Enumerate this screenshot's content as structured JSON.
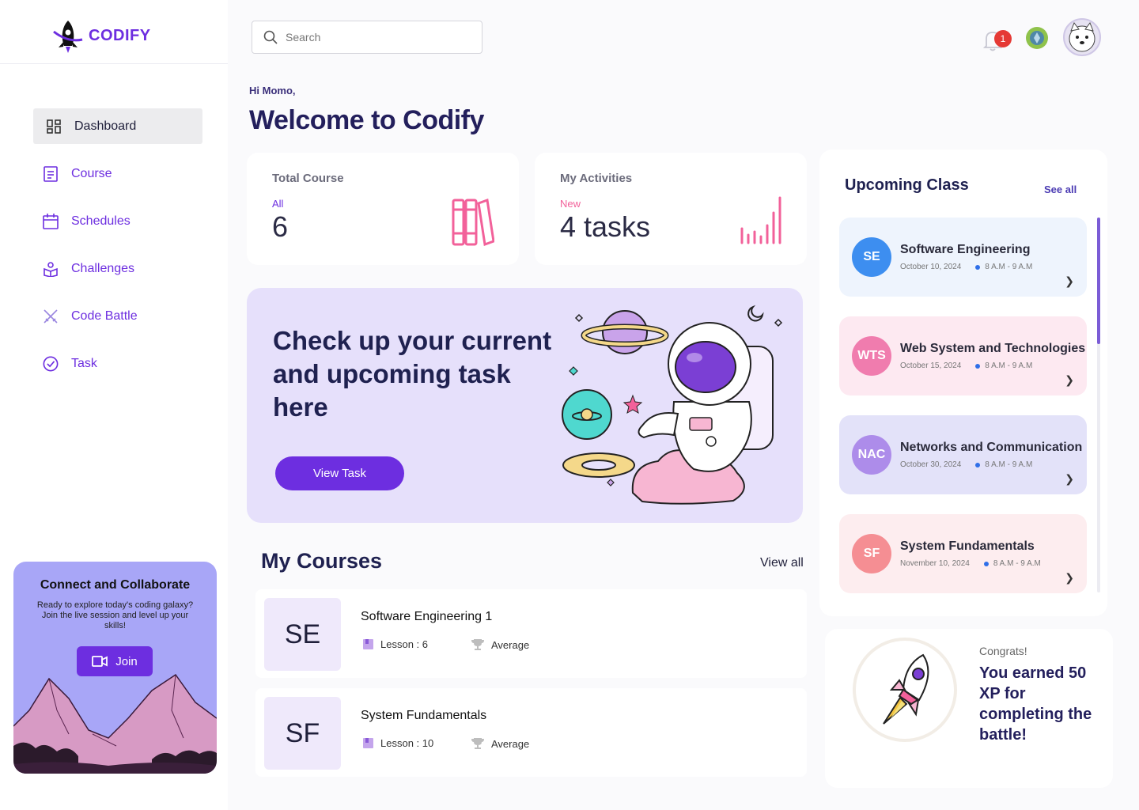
{
  "brand": {
    "name": "CODIFY"
  },
  "sidebar": {
    "items": [
      {
        "label": "Dashboard",
        "icon": "dashboard-icon",
        "active": true
      },
      {
        "label": "Course",
        "icon": "course-icon",
        "active": false
      },
      {
        "label": "Schedules",
        "icon": "calendar-icon",
        "active": false
      },
      {
        "label": "Challenges",
        "icon": "challenges-icon",
        "active": false
      },
      {
        "label": "Code Battle",
        "icon": "swords-icon",
        "active": false
      },
      {
        "label": "Task",
        "icon": "check-circle-icon",
        "active": false
      }
    ],
    "collab": {
      "title": "Connect and Collaborate",
      "text": "Ready to explore today's coding galaxy? Join the live session and level up your skills!",
      "join_label": "Join"
    }
  },
  "header": {
    "search_placeholder": "Search",
    "notification_count": "1"
  },
  "greeting": "Hi Momo,",
  "welcome": "Welcome  to Codify",
  "stats": {
    "total_course": {
      "title": "Total Course",
      "sub": "All",
      "value": "6"
    },
    "activities": {
      "title": "My Activities",
      "sub": "New",
      "value": "4 tasks"
    }
  },
  "hero": {
    "text": "Check up your current and upcoming task here",
    "button": "View Task"
  },
  "courses": {
    "title": "My Courses",
    "view_all": "View all",
    "items": [
      {
        "abbr": "SE",
        "name": "Software Engineering 1",
        "lesson": "Lesson : 6",
        "level": "Average"
      },
      {
        "abbr": "SF",
        "name": "System Fundamentals",
        "lesson": "Lesson : 10",
        "level": "Average"
      }
    ]
  },
  "upcoming": {
    "title": "Upcoming Class",
    "see_all": "See all",
    "items": [
      {
        "abbr": "SE",
        "name": "Software Engineering",
        "date": "October 10, 2024",
        "time": "8 A.M - 9 A.M",
        "badge_color": "#3d8ef0",
        "card_color": "#eef4fd"
      },
      {
        "abbr": "WTS",
        "name": "Web System and Technologies",
        "date": "October 15, 2024",
        "time": "8 A.M - 9 A.M",
        "badge_color": "#f07cae",
        "card_color": "#fde9f1"
      },
      {
        "abbr": "NAC",
        "name": "Networks and Communication",
        "date": "October 30, 2024",
        "time": "8 A.M - 9 A.M",
        "badge_color": "#ad8cea",
        "card_color": "#e3e2f9"
      },
      {
        "abbr": "SF",
        "name": "System Fundamentals",
        "date": "November 10, 2024",
        "time": "8 A.M - 9 A.M",
        "badge_color": "#f58e93",
        "card_color": "#fdedef"
      }
    ]
  },
  "congrats": {
    "small": "Congrats!",
    "big": "You earned 50 XP for completing the battle!"
  },
  "colors": {
    "accent": "#6d2ee0",
    "heading": "#231f5c",
    "pink": "#f2619a"
  }
}
